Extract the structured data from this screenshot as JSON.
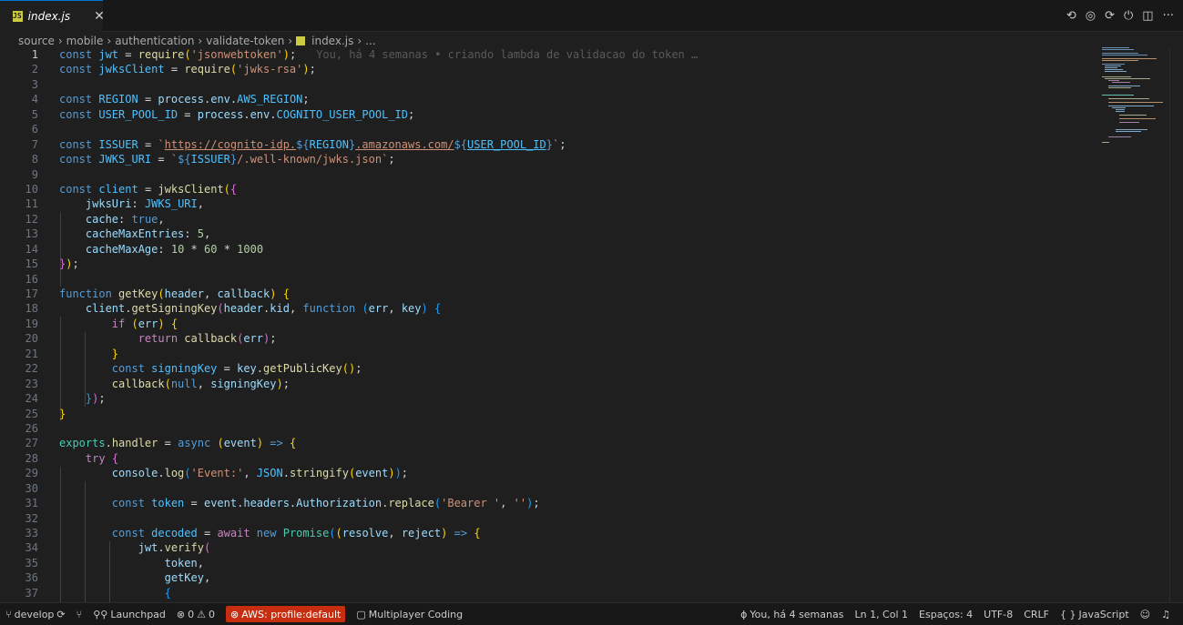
{
  "tab": {
    "label": "index.js",
    "close": "✕"
  },
  "editor_actions": [
    "⟲",
    "◎",
    "⟳",
    "⏻",
    "◫",
    "···"
  ],
  "breadcrumb": [
    "source",
    "mobile",
    "authentication",
    "validate-token",
    "index.js",
    "..."
  ],
  "blame": "You, há 4 semanas • criando lambda de validacao do token …",
  "lines": [
    "const jwt = require('jsonwebtoken');",
    "const jwksClient = require('jwks-rsa');",
    "",
    "const REGION = process.env.AWS_REGION;",
    "const USER_POOL_ID = process.env.COGNITO_USER_POOL_ID;",
    "",
    "const ISSUER = `https://cognito-idp.${REGION}.amazonaws.com/${USER_POOL_ID}`;",
    "const JWKS_URI = `${ISSUER}/.well-known/jwks.json`;",
    "",
    "const client = jwksClient({",
    "    jwksUri: JWKS_URI,",
    "    cache: true,",
    "    cacheMaxEntries: 5,",
    "    cacheMaxAge: 10 * 60 * 1000",
    "});",
    "",
    "function getKey(header, callback) {",
    "    client.getSigningKey(header.kid, function (err, key) {",
    "        if (err) {",
    "            return callback(err);",
    "        }",
    "        const signingKey = key.getPublicKey();",
    "        callback(null, signingKey);",
    "    });",
    "}",
    "",
    "exports.handler = async (event) => {",
    "    try {",
    "        console.log('Event:', JSON.stringify(event));",
    "",
    "        const token = event.headers.Authorization.replace('Bearer ', '');",
    "",
    "        const decoded = await new Promise((resolve, reject) => {",
    "            jwt.verify(",
    "                token,",
    "                getKey,",
    "                {"
  ],
  "line_numbers": [
    "1",
    "2",
    "3",
    "4",
    "5",
    "6",
    "7",
    "8",
    "9",
    "10",
    "11",
    "12",
    "13",
    "14",
    "15",
    "16",
    "17",
    "18",
    "19",
    "20",
    "21",
    "22",
    "23",
    "24",
    "25",
    "26",
    "27",
    "28",
    "29",
    "30",
    "31",
    "32",
    "33",
    "34",
    "35",
    "36",
    "37"
  ],
  "status": {
    "branch": "develop",
    "launchpad": "Launchpad",
    "errors": "0",
    "warnings": "0",
    "aws_profile": "AWS: profile:default",
    "multiplayer": "Multiplayer Coding",
    "blame": "You, há 4 semanas",
    "position": "Ln 1, Col 1",
    "spaces": "Espaços: 4",
    "encoding": "UTF-8",
    "eol": "CRLF",
    "language": "JavaScript"
  },
  "colors": {
    "editor_bg": "#1f1f1f",
    "tab_active_border": "#0078d4",
    "aws_badge": "#c72e0f"
  }
}
